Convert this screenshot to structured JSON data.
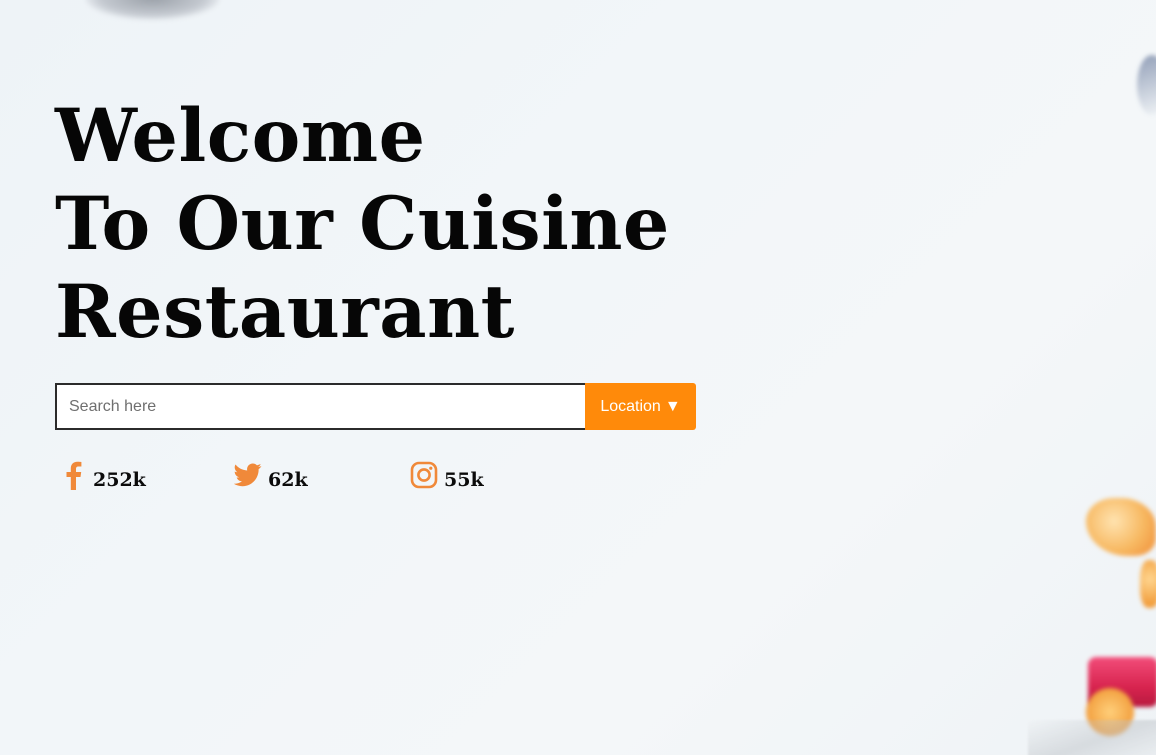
{
  "hero": {
    "title_lines": [
      "Welcome",
      "To Our Cuisine",
      "Restaurant"
    ]
  },
  "search": {
    "placeholder": "Search here",
    "value": "",
    "location_label": "Location",
    "location_caret": "▼"
  },
  "social": [
    {
      "network": "facebook",
      "icon": "facebook-icon",
      "count": "252k"
    },
    {
      "network": "twitter",
      "icon": "twitter-icon",
      "count": "62k"
    },
    {
      "network": "instagram",
      "icon": "instagram-icon",
      "count": "55k"
    }
  ],
  "colors": {
    "accent": "#ff8a0a",
    "icon_orange": "#f0893a",
    "text": "#060606",
    "background": "#eef3f7"
  }
}
